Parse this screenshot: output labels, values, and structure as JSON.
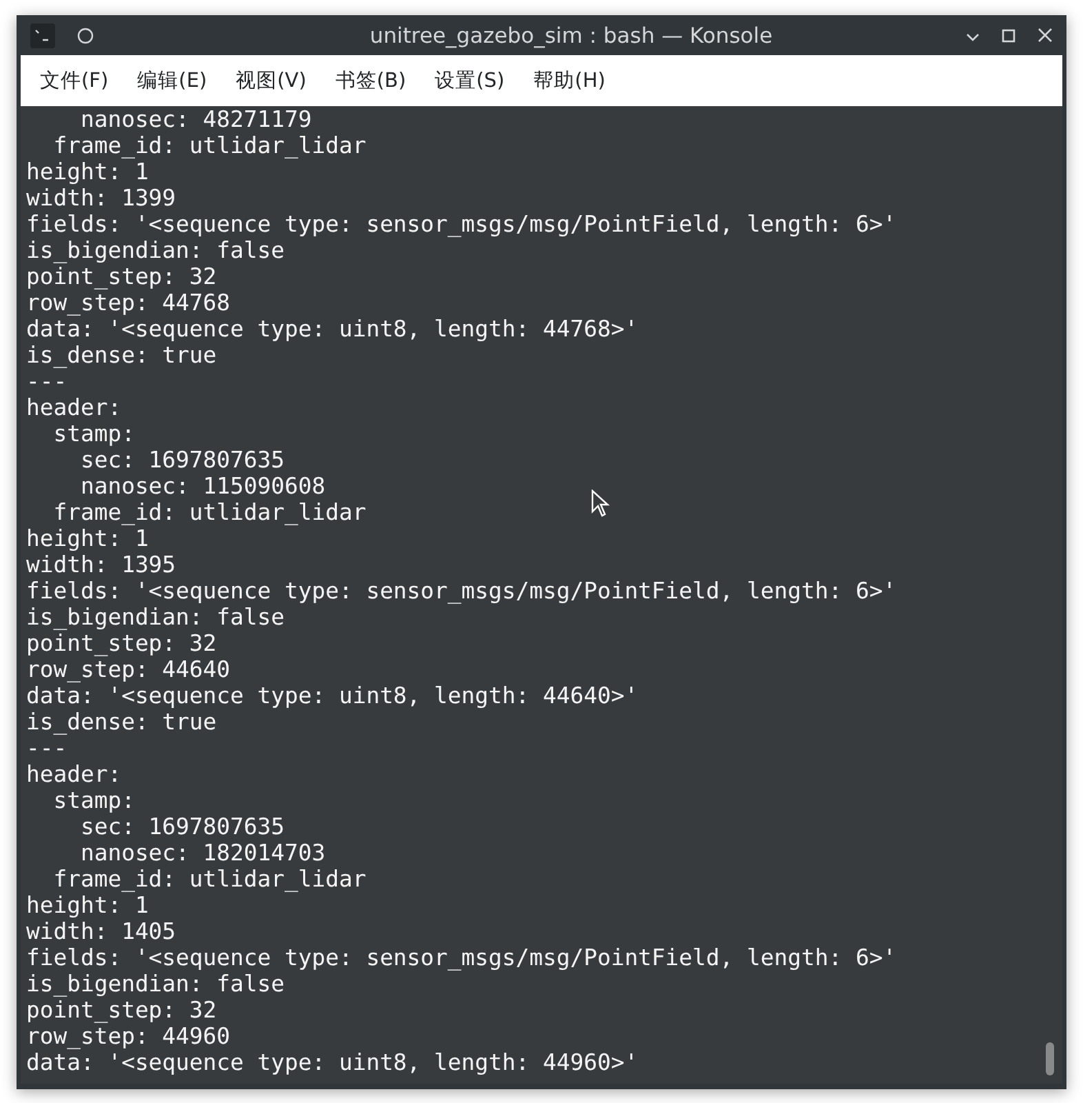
{
  "window": {
    "title": "unitree_gazebo_sim : bash — Konsole"
  },
  "menu": [
    "文件(F)",
    "编辑(E)",
    "视图(V)",
    "书签(B)",
    "设置(S)",
    "帮助(H)"
  ],
  "terminal_lines": [
    "    nanosec: 48271179",
    "  frame_id: utlidar_lidar",
    "height: 1",
    "width: 1399",
    "fields: '<sequence type: sensor_msgs/msg/PointField, length: 6>'",
    "is_bigendian: false",
    "point_step: 32",
    "row_step: 44768",
    "data: '<sequence type: uint8, length: 44768>'",
    "is_dense: true",
    "---",
    "header:",
    "  stamp:",
    "    sec: 1697807635",
    "    nanosec: 115090608",
    "  frame_id: utlidar_lidar",
    "height: 1",
    "width: 1395",
    "fields: '<sequence type: sensor_msgs/msg/PointField, length: 6>'",
    "is_bigendian: false",
    "point_step: 32",
    "row_step: 44640",
    "data: '<sequence type: uint8, length: 44640>'",
    "is_dense: true",
    "---",
    "header:",
    "  stamp:",
    "    sec: 1697807635",
    "    nanosec: 182014703",
    "  frame_id: utlidar_lidar",
    "height: 1",
    "width: 1405",
    "fields: '<sequence type: sensor_msgs/msg/PointField, length: 6>'",
    "is_bigendian: false",
    "point_step: 32",
    "row_step: 44960",
    "data: '<sequence type: uint8, length: 44960>'"
  ]
}
